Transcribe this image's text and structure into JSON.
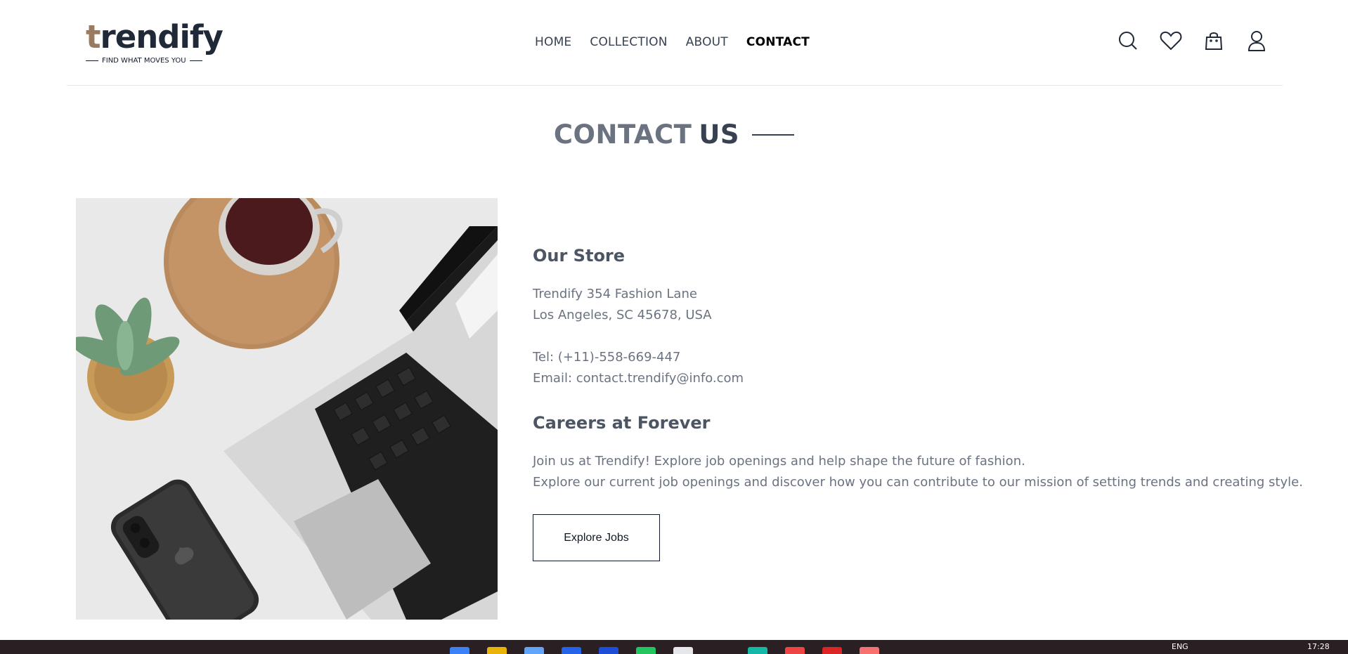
{
  "brand": {
    "name_prefix": "t",
    "name_rest": "rendify",
    "tagline": "FIND WHAT MOVES YOU"
  },
  "nav": {
    "items": [
      {
        "label": "HOME",
        "active": false
      },
      {
        "label": "COLLECTION",
        "active": false
      },
      {
        "label": "ABOUT",
        "active": false
      },
      {
        "label": "CONTACT",
        "active": true
      }
    ]
  },
  "header_icons": [
    "search-icon",
    "heart-icon",
    "shopping-bag-icon",
    "user-icon"
  ],
  "page_title": {
    "part1": "CONTACT",
    "part2": "US"
  },
  "store": {
    "heading": "Our Store",
    "address_line1": "Trendify 354 Fashion Lane",
    "address_line2": "Los Angeles, SC 45678, USA",
    "tel": "Tel: (+11)-558-669-447",
    "email": "Email: contact.trendify@info.com"
  },
  "careers": {
    "heading": "Careers at Forever",
    "line1": "Join us at Trendify! Explore job openings and help shape the future of fashion.",
    "line2": "Explore our current job openings and discover how you can contribute to our mission of setting trends and creating style.",
    "button_label": "Explore Jobs"
  },
  "taskbar": {
    "language": "ENG",
    "time": "17:28"
  },
  "colors": {
    "accent_brown": "#9a7b5f",
    "text_dark": "#374151",
    "text_muted": "#6b7280",
    "taskbar_bg": "#2a1f22"
  }
}
